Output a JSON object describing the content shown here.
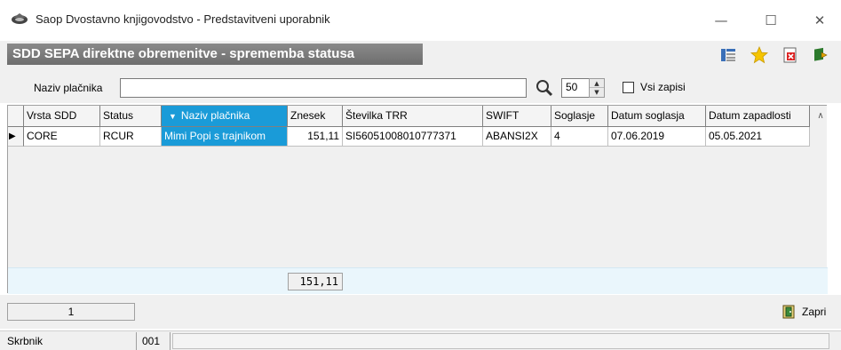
{
  "window": {
    "title": "Saop Dvostavno knjigovodstvo - Predstavitveni uporabnik",
    "minimize": "—",
    "maximize": "☐",
    "close": "✕"
  },
  "header": {
    "title": "SDD SEPA direktne obremenitve - sprememba statusa",
    "icons": [
      "columns-icon",
      "star-icon",
      "delete-document-icon",
      "exit-arrow-icon"
    ]
  },
  "filter": {
    "label": "Naziv plačnika",
    "value": "",
    "count": "50",
    "all_records_label": "Vsi zapisi",
    "all_records_checked": false
  },
  "grid": {
    "columns": [
      "Vrsta SDD",
      "Status",
      "Naziv plačnika",
      "Znesek",
      "Številka TRR",
      "SWIFT",
      "Soglasje",
      "Datum soglasja",
      "Datum zapadlosti"
    ],
    "sorted_column": "Naziv plačnika",
    "rows": [
      {
        "vrsta": "CORE",
        "status": "RCUR",
        "naziv": "Mimi Popi s trajnikom",
        "znesek": "151,11",
        "trr": "SI56051008010777371",
        "swift": "ABANSI2X",
        "soglasje": "4",
        "datum_soglasja": "07.06.2019",
        "datum_zapadlosti": "05.05.2021"
      }
    ],
    "sum_znesek": "151,11"
  },
  "footer": {
    "page": "1",
    "close_label": "Zapri"
  },
  "status_bar": {
    "user": "Skrbnik",
    "code": "001"
  },
  "colors": {
    "selection": "#1a9bd8",
    "header_band": "#7a7a7a",
    "sum_band": "#eaf6fc"
  }
}
